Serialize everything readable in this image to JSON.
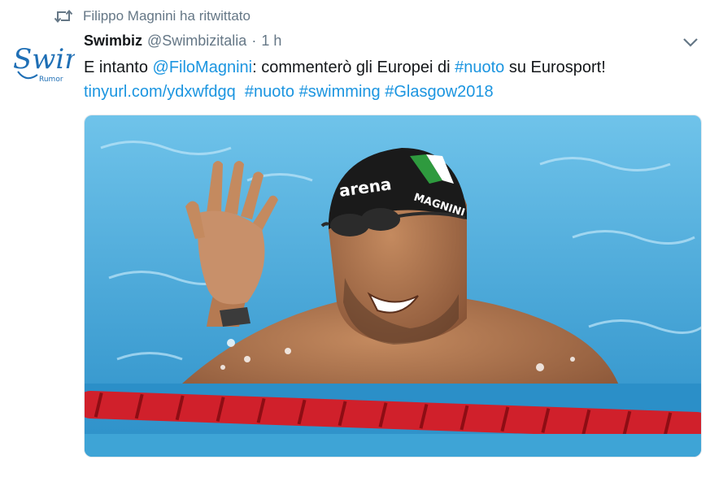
{
  "retweet_context": {
    "text": "Filippo Magnini ha ritwittato",
    "icon": "retweet-icon"
  },
  "author": {
    "name": "Swimbiz",
    "handle": "@Swimbizitalia",
    "separator": "·",
    "time": "1 h",
    "avatar_text": "Swim",
    "avatar_subtext": "Rumor"
  },
  "tweet": {
    "text_1": "E intanto ",
    "mention": "@FiloMagnini",
    "text_2": ": commenterò gli Europei di ",
    "hashtag_1": "#nuoto",
    "text_3": " su Eurosport!",
    "link": "tinyurl.com/ydxwfdgq",
    "hashtag_2": "#nuoto",
    "hashtag_3": "#swimming",
    "hashtag_4": "#Glasgow2018"
  },
  "media": {
    "cap_brand": "arena",
    "cap_name": "MAGNINI",
    "icon": "photo"
  },
  "colors": {
    "link": "#1b95e0",
    "meta": "#657786",
    "text": "#14171a",
    "pool": "#3aa6d8",
    "lane": "#d0202b"
  }
}
